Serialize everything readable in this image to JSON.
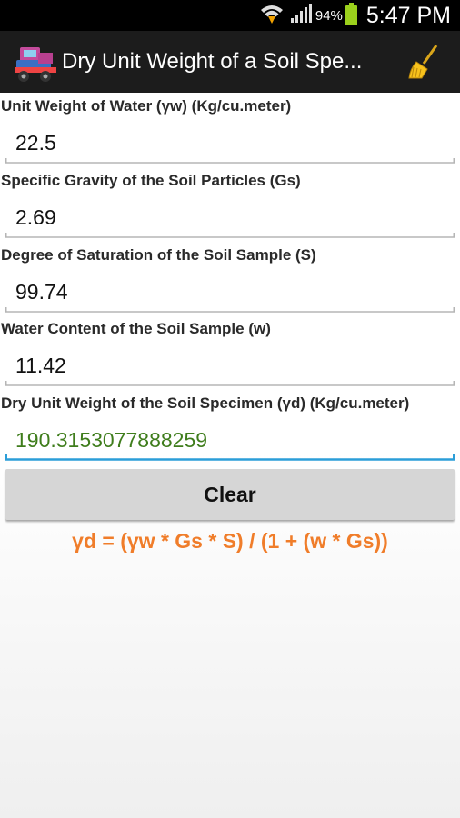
{
  "status_bar": {
    "battery": "94%",
    "time": "5:47 PM",
    "icons": [
      "wifi-icon",
      "signal-icon",
      "battery-icon"
    ]
  },
  "action_bar": {
    "title": "Dry Unit Weight of a Soil Spe...",
    "app_icon": "soil-truck-icon",
    "action_icon": "broom-icon"
  },
  "fields": [
    {
      "label": "Unit Weight of Water (γw) (Kg/cu.meter)",
      "value": "22.5"
    },
    {
      "label": "Specific Gravity of the Soil Particles (Gs)",
      "value": "2.69"
    },
    {
      "label": "Degree of Saturation of the Soil Sample (S)",
      "value": "99.74"
    },
    {
      "label": "Water Content of the Soil Sample (w)",
      "value": "11.42"
    }
  ],
  "result": {
    "label": "Dry Unit Weight of the Soil Specimen (γd) (Kg/cu.meter)",
    "value": "190.3153077888259"
  },
  "clear_button": "Clear",
  "formula": "γd = (γw * Gs * S) / (1 + (w * Gs))",
  "colors": {
    "status_bar": "#000000",
    "action_bar": "#1c1c1c",
    "result_text": "#3f7d1c",
    "focus_underline": "#2b9ed8",
    "formula": "#f07d2a",
    "button": "#d6d6d6"
  }
}
